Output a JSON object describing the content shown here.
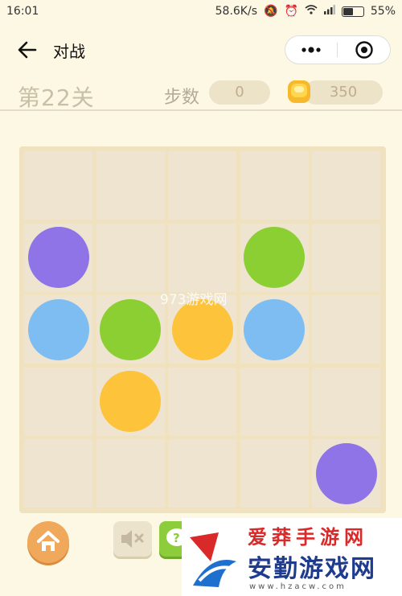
{
  "status": {
    "time": "16:01",
    "network_speed": "58.6K/s",
    "battery_percent": "55%",
    "battery_level": 0.55
  },
  "navbar": {
    "title": "对战"
  },
  "info": {
    "level_label": "第22关",
    "steps_label": "步数",
    "steps_value": "0",
    "coins": "350"
  },
  "board": {
    "rows": 5,
    "cols": 5,
    "pieces": [
      {
        "row": 1,
        "col": 0,
        "color": "purple"
      },
      {
        "row": 1,
        "col": 3,
        "color": "green"
      },
      {
        "row": 2,
        "col": 0,
        "color": "blue"
      },
      {
        "row": 2,
        "col": 1,
        "color": "green"
      },
      {
        "row": 2,
        "col": 2,
        "color": "yellow"
      },
      {
        "row": 2,
        "col": 3,
        "color": "blue"
      },
      {
        "row": 3,
        "col": 1,
        "color": "yellow"
      },
      {
        "row": 4,
        "col": 4,
        "color": "purple"
      }
    ]
  },
  "colors": {
    "purple": "#8e74e6",
    "green": "#8ccf33",
    "blue": "#7dbdf2",
    "yellow": "#fdc33a",
    "accent": "#f0a85a"
  },
  "watermark": "973游戏网",
  "logo": {
    "top": "爱莽手游网",
    "name": "安勤游戏网",
    "url": "www.hzacw.com"
  },
  "icons": {
    "back": "arrow-left-icon",
    "more": "more-dots-icon",
    "close": "target-close-icon",
    "coin": "coin-icon",
    "home": "home-icon",
    "mute": "speaker-mute-icon",
    "hint": "question-bubble-icon"
  }
}
